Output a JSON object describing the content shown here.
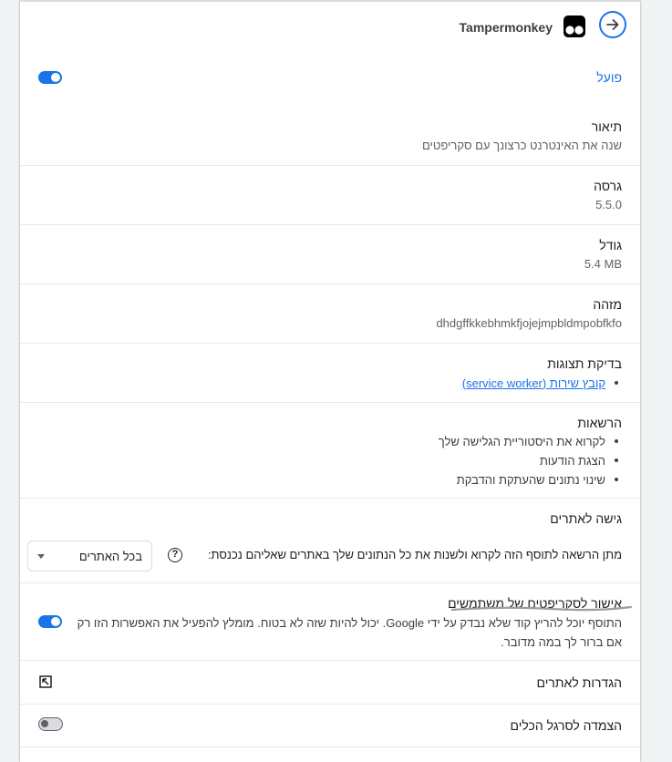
{
  "header": {
    "extension_name": "Tampermonkey",
    "back_icon": "arrow-circle-icon",
    "extension_icon": "tampermonkey-logo-icon"
  },
  "status": {
    "label": "פועל",
    "enabled": true
  },
  "description": {
    "label": "תיאור",
    "value": "שנה את האינטרנט כרצונך עם סקריפטים"
  },
  "version": {
    "label": "גרסה",
    "value": "5.5.0"
  },
  "size": {
    "label": "גודל",
    "value": "5.4 MB"
  },
  "id": {
    "label": "מזהה",
    "value": "dhdgffkkebhmkfjojejmpbldmpobfkfo"
  },
  "inspect_views": {
    "label": "בדיקת תצוגות",
    "link": "קובץ שירות (service worker)"
  },
  "permissions": {
    "label": "הרשאות",
    "items": [
      "לקרוא את היסטוריית הגלישה שלך",
      "הצגת הודעות",
      "שינוי נתונים שהעתקת והדבקת"
    ]
  },
  "site_access": {
    "label": "גישה לאתרים",
    "description": "מתן הרשאה לתוסף הזה לקרוא ולשנות את כל הנתונים שלך באתרים שאליהם נכנסת:",
    "selected": "בכל האתרים"
  },
  "user_scripts": {
    "label": "אישור לסקריפטים של משתמשים",
    "description": "התוסף יוכל להריץ קוד שלא נבדק על ידי Google. יכול להיות שזה לא בטוח. מומלץ להפעיל את האפשרות הזו רק אם ברור לך במה מדובר.",
    "enabled": true
  },
  "site_settings": {
    "label": "הגדרות לאתרים"
  },
  "pin_toolbar": {
    "label": "הצמדה לסרגל הכלים",
    "enabled": false
  },
  "colors": {
    "accent": "#1a73e8",
    "divider": "#e8eaed"
  }
}
